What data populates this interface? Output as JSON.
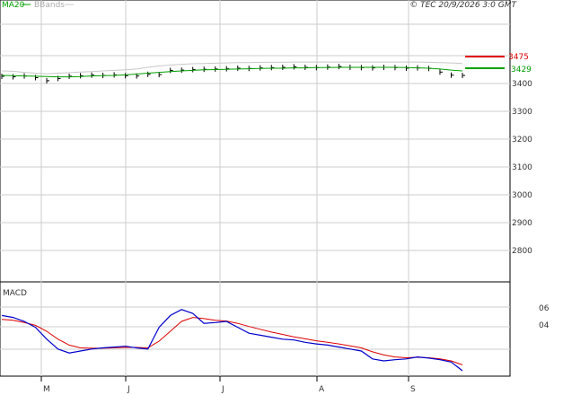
{
  "legend": {
    "ma_label": "MA20",
    "bb_label": "BBands"
  },
  "copyright": "© TEC 20/9/2026 3:0 GMT",
  "macd_label": "MACD",
  "price_labels": {
    "last_close": "3429",
    "ma_value": "3475"
  },
  "colors": {
    "ma": "#00a000",
    "bb": "#c8c8c8",
    "price": "#000000",
    "macd": "#0000cc",
    "signal": "#dd0000",
    "grid": "#cccccc",
    "frame": "#000000",
    "label_red": "#dd0000",
    "label_green": "#00a000"
  },
  "chart_data": [
    {
      "type": "line",
      "title": "",
      "ylim": [
        2700,
        3500
      ],
      "ytick_labels": [
        "3400",
        "3300",
        "3200",
        "3100",
        "3000",
        "2900",
        "2800"
      ],
      "x_month_labels": [
        "M",
        "J",
        "J",
        "A",
        "S"
      ],
      "series": [
        {
          "name": "",
          "values": [
            3426,
            3424,
            3427,
            3421,
            3410,
            3418,
            3426,
            3428,
            3430,
            3429,
            3431,
            3428,
            3427,
            3433,
            3432,
            3447,
            3448,
            3450,
            3451,
            3452,
            3453,
            3455,
            3454,
            3456,
            3457,
            3458,
            3460,
            3458,
            3457,
            3459,
            3461,
            3458,
            3457,
            3456,
            3458,
            3457,
            3455,
            3456,
            3454,
            3441,
            3430,
            3429
          ]
        },
        {
          "name": "MA20",
          "values": [
            3429,
            3428,
            3427,
            3426,
            3425,
            3424,
            3424,
            3425,
            3427,
            3428,
            3429,
            3431,
            3434,
            3437,
            3440,
            3443,
            3445,
            3447,
            3449,
            3450,
            3451,
            3452,
            3453,
            3454,
            3455,
            3455,
            3456,
            3456,
            3457,
            3457,
            3458,
            3458,
            3458,
            3458,
            3458,
            3458,
            3457,
            3456,
            3455,
            3452,
            3448,
            3445
          ]
        },
        {
          "name": "BBands",
          "values": [
            3445,
            3444,
            3440,
            3437,
            3435,
            3437,
            3439,
            3441,
            3443,
            3445,
            3447,
            3449,
            3452,
            3458,
            3463,
            3466,
            3469,
            3471,
            3472,
            3473,
            3474,
            3475,
            3475,
            3476,
            3476,
            3476,
            3477,
            3477,
            3477,
            3477,
            3477,
            3477,
            3477,
            3477,
            3477,
            3477,
            3477,
            3477,
            3476,
            3475,
            3474,
            3472
          ]
        }
      ]
    },
    {
      "type": "line",
      "title": "MACD",
      "ylim": [
        -100,
        100
      ],
      "ytick_labels": [
        "06",
        "04"
      ],
      "series": [
        {
          "name": "",
          "values": [
            40,
            35,
            25,
            10,
            -20,
            -45,
            -55,
            -50,
            -45,
            -42,
            -40,
            -38,
            -42,
            -45,
            10,
            40,
            55,
            45,
            20,
            22,
            25,
            10,
            -5,
            -10,
            -15,
            -20,
            -22,
            -28,
            -32,
            -35,
            -40,
            -45,
            -50,
            -70,
            -75,
            -72,
            -70,
            -65,
            -68,
            -72,
            -78,
            -100
          ]
        },
        {
          "name": "",
          "values": [
            30,
            28,
            22,
            15,
            0,
            -20,
            -35,
            -42,
            -43,
            -43,
            -42,
            -41,
            -41,
            -42,
            -25,
            0,
            25,
            35,
            32,
            28,
            26,
            20,
            12,
            5,
            -2,
            -8,
            -14,
            -19,
            -24,
            -28,
            -32,
            -37,
            -42,
            -52,
            -60,
            -65,
            -67,
            -66,
            -67,
            -70,
            -75,
            -85
          ]
        }
      ]
    }
  ]
}
